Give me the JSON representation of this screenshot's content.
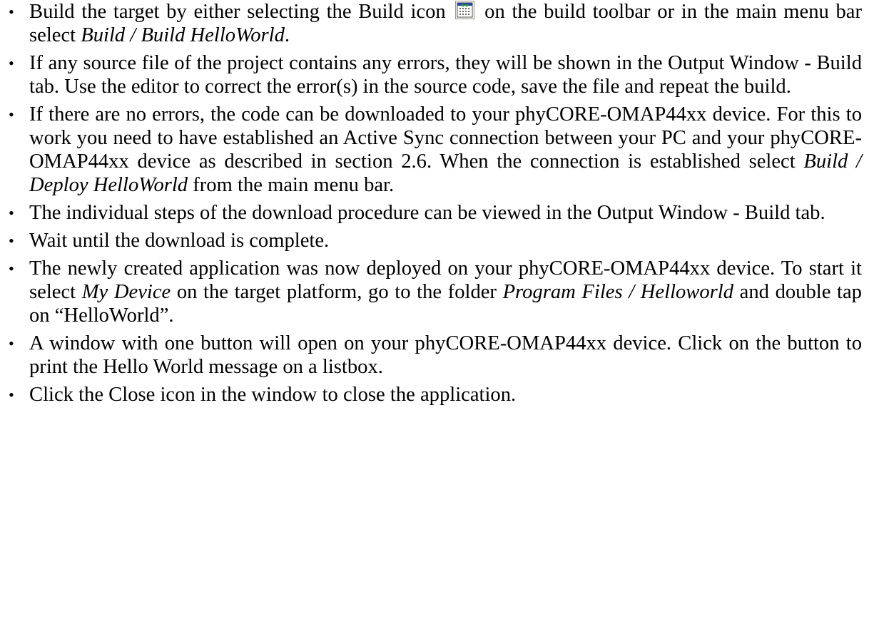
{
  "bullet_char": "•",
  "icon_name": "build-icon",
  "items": [
    {
      "a": "Build the target by either selecting the Build icon",
      "b": "on the build toolbar or in the main menu bar select",
      "c_italic": "Build / Build HelloWorld",
      "d": "."
    },
    {
      "text": "If any source file of the project contains any errors, they will be shown in the Output Window - Build tab. Use the editor to correct the error(s) in the source code, save the file and repeat the build."
    },
    {
      "a": "If there are no errors, the code can be downloaded to your phyCORE-OMAP44xx device. For this to work you need to have established an Active Sync connection between your PC and your phyCORE-OMAP44xx device as described in section 2.6. When the connection is established select",
      "b_italic": "Build / Deploy HelloWorld",
      "c": "from the main menu bar."
    },
    {
      "text": "The individual steps of the download procedure can be viewed in the Output Window - Build tab."
    },
    {
      "text": "Wait until the download is complete."
    },
    {
      "a": "The newly created application was now deployed on your phyCORE-OMAP44xx device. To start it select",
      "b_italic": "My Device",
      "c": "on the target platform, go to the folder",
      "d_italic": "Program Files / Helloworld",
      "e": "and double tap on “HelloWorld”."
    },
    {
      "text": "A window with one button will open on your phyCORE-OMAP44xx device. Click on the button to print the Hello World message on a listbox."
    },
    {
      "text": "Click the Close icon in the window to close the application."
    }
  ]
}
